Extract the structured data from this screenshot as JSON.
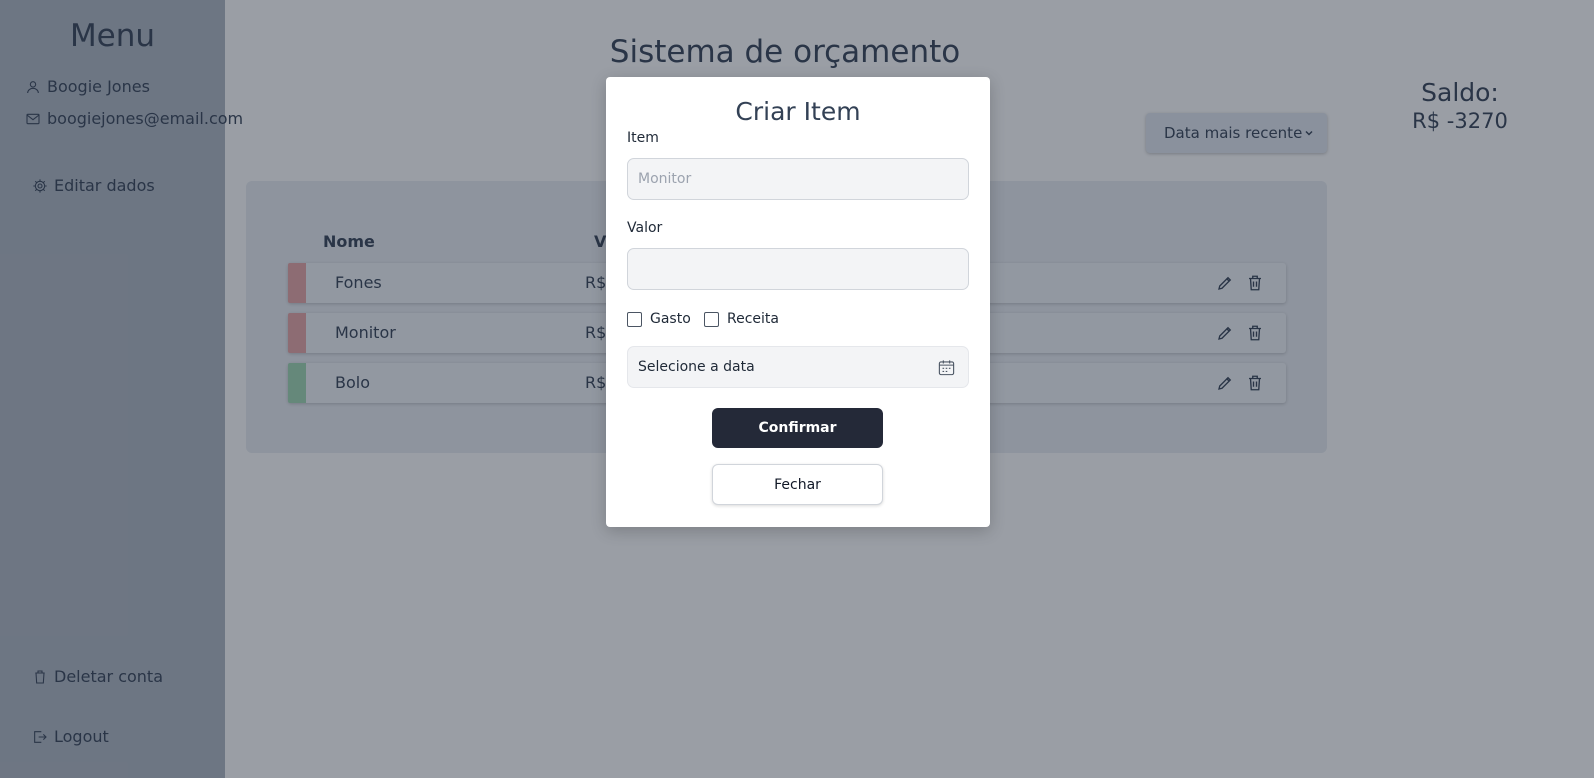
{
  "sidebar": {
    "title": "Menu",
    "user_name": "Boogie Jones",
    "user_email": "boogiejones@email.com",
    "edit_label": "Editar dados",
    "delete_label": "Deletar conta",
    "logout_label": "Logout"
  },
  "main": {
    "title": "Sistema de orçamento",
    "saldo_label": "Saldo:",
    "saldo_value": "R$ -3270",
    "sort_selected": "Data mais recente",
    "table": {
      "headers": {
        "nome": "Nome",
        "valor": "V"
      },
      "rows": [
        {
          "nome": "Fones",
          "valor": "R$",
          "type_color": "#e8a4a4"
        },
        {
          "nome": "Monitor",
          "valor": "R$",
          "type_color": "#e8a4a4"
        },
        {
          "nome": "Bolo",
          "valor": "R$",
          "type_color": "#9fd7b1"
        }
      ]
    }
  },
  "modal": {
    "title": "Criar Item",
    "item_label": "Item",
    "item_placeholder": "Monitor",
    "item_value": "",
    "valor_label": "Valor",
    "valor_value": "",
    "gasto_label": "Gasto",
    "receita_label": "Receita",
    "date_placeholder": "Selecione a data",
    "confirm_label": "Confirmar",
    "close_label": "Fechar"
  },
  "colors": {
    "sidebar_bg": "#aeb6c2",
    "overlay": "rgba(31,41,55,0.45)",
    "confirm_bg": "#242938",
    "expense": "#e8a4a4",
    "income": "#9fd7b1"
  },
  "icons": {
    "user": "user-icon",
    "mail": "mail-icon",
    "settings": "gear-icon",
    "trash": "trash-icon",
    "logout": "logout-icon",
    "edit": "pencil-icon",
    "calendar": "calendar-icon",
    "chevron": "chevron-down-icon"
  }
}
